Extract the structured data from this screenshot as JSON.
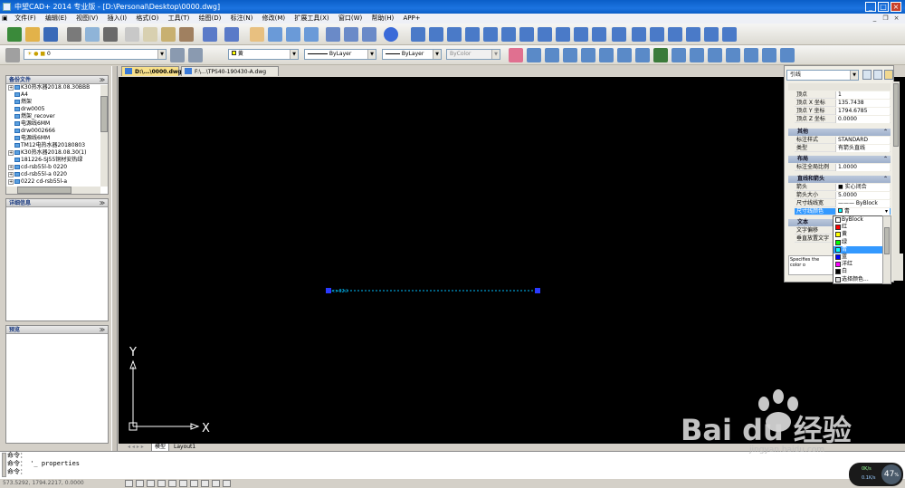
{
  "window": {
    "title": "中望CAD+ 2014 专业版 - [D:\\Personal\\Desktop\\0000.dwg]"
  },
  "menu": [
    "文件(F)",
    "编辑(E)",
    "视图(V)",
    "插入(I)",
    "格式(O)",
    "工具(T)",
    "绘图(D)",
    "标注(N)",
    "修改(M)",
    "扩展工具(X)",
    "窗口(W)",
    "帮助(H)",
    "APP+"
  ],
  "toolbar": {
    "layer_combo": "0",
    "color_combo": "黄",
    "linetype_combo": "ByLayer",
    "lineweight_combo": "ByLayer",
    "plotstyle_combo": "ByColor"
  },
  "tabs": [
    "D:\\...\\0000.dwg",
    "F:\\...\\TPS40-190430-A.dwg"
  ],
  "left_panel": {
    "library_title": "备份文件",
    "tree": [
      "K30热水器2018.08.30BBB",
      "A4",
      "燃架",
      "drw0005",
      "燃架_recover",
      "电源线6MM",
      "drw0002666",
      "电源线6MM",
      "TM12电热水器20180803",
      "K30热水器2018.08.30(1)",
      "181226-SJ55铜材安热绿",
      "cd-rsb55l-b 0220",
      "cd-rsb55l-a 0220",
      "0222 cd-rsb55l-a"
    ],
    "detail_title": "详细信息",
    "preview_title": "预览"
  },
  "canvas": {
    "ucs_y": "Y",
    "ucs_x": "X",
    "dim_text": "<>02∅"
  },
  "layout_tabs": {
    "model": "模型",
    "layout1": "Layout1"
  },
  "properties": {
    "object_type": "引线",
    "rows_top": [
      {
        "k": "顶点",
        "v": "1"
      },
      {
        "k": "顶点 X 坐标",
        "v": "135.7438"
      },
      {
        "k": "顶点 Y 坐标",
        "v": "1794.6785"
      },
      {
        "k": "顶点 Z 坐标",
        "v": "0.0000"
      }
    ],
    "sec_other": "其他",
    "rows_other": [
      {
        "k": "标注样式",
        "v": "STANDARD"
      },
      {
        "k": "类型",
        "v": "有箭头直线"
      }
    ],
    "sec_fit": "布局",
    "rows_fit": [
      {
        "k": "标注全局比例",
        "v": "1.0000"
      }
    ],
    "sec_arrow": "直线和箭头",
    "rows_arrow": [
      {
        "k": "箭头",
        "v": "■ 实心闭合"
      },
      {
        "k": "箭头大小",
        "v": "5.0000"
      },
      {
        "k": "尺寸线线宽",
        "v": "——— ByBlock"
      },
      {
        "k": "尺寸线颜色",
        "v": "青"
      }
    ],
    "sec_text": "文本",
    "rows_text": [
      {
        "k": "文字偏移",
        "v": ""
      },
      {
        "k": "垂直放置文字",
        "v": ""
      }
    ],
    "desc": "Specifies the color o",
    "color_list": [
      {
        "name": "ByBlock",
        "color": "#ffffff"
      },
      {
        "name": "红",
        "color": "#ff0000"
      },
      {
        "name": "黄",
        "color": "#ffff00"
      },
      {
        "name": "绿",
        "color": "#00ff00"
      },
      {
        "name": "青",
        "color": "#00ffff"
      },
      {
        "name": "蓝",
        "color": "#0000ff"
      },
      {
        "name": "洋红",
        "color": "#ff00ff"
      },
      {
        "name": "白",
        "color": "#000000"
      },
      {
        "name": "选择颜色...",
        "color": "#dddddd"
      }
    ]
  },
  "command": {
    "line1": "命令：",
    "line2": "命令：  '_ properties",
    "line3": "命令："
  },
  "status": {
    "coords": "573.5292, 1794.2217, 0.0000"
  },
  "net": {
    "percent": "47",
    "up": "0K/s",
    "down": "0.1K/s"
  },
  "watermark": {
    "brand": "Bai du 经验",
    "url": "jingyan.baidu.com"
  },
  "colors": {
    "accent": "#0a5ec8",
    "canvas": "#000000",
    "highlight": "#3399ff"
  }
}
